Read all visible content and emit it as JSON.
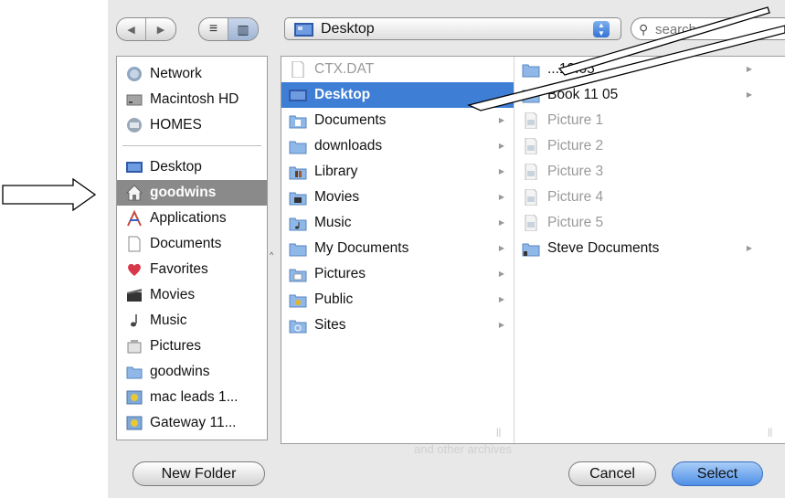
{
  "toolbar": {
    "back_glyph": "◀",
    "forward_glyph": "▶",
    "list_view_glyph": "≡",
    "column_view_glyph": "▥",
    "location": "Desktop",
    "search_placeholder": "search"
  },
  "sidebar": {
    "devices": [
      {
        "label": "Network",
        "icon": "network-icon"
      },
      {
        "label": "Macintosh HD",
        "icon": "hard-drive-icon"
      },
      {
        "label": "HOMES",
        "icon": "network-share-icon"
      }
    ],
    "places": [
      {
        "label": "Desktop",
        "icon": "desktop-icon"
      },
      {
        "label": "goodwins",
        "icon": "home-icon",
        "selected": true
      },
      {
        "label": "Applications",
        "icon": "applications-icon"
      },
      {
        "label": "Documents",
        "icon": "documents-icon"
      },
      {
        "label": "Favorites",
        "icon": "favorites-icon"
      },
      {
        "label": "Movies",
        "icon": "movies-icon"
      },
      {
        "label": "Music",
        "icon": "music-icon"
      },
      {
        "label": "Pictures",
        "icon": "pictures-icon"
      },
      {
        "label": "goodwins",
        "icon": "folder-icon"
      },
      {
        "label": "mac leads 1...",
        "icon": "disk-image-icon"
      },
      {
        "label": "Gateway 11...",
        "icon": "disk-image-icon"
      }
    ]
  },
  "column1": [
    {
      "label": "CTX.DAT",
      "icon": "file-icon",
      "dim": true,
      "chevron": false
    },
    {
      "label": "Desktop",
      "icon": "desktop-icon",
      "selected": true,
      "chevron": false
    },
    {
      "label": "Documents",
      "icon": "documents-folder-icon",
      "chevron": true
    },
    {
      "label": "downloads",
      "icon": "folder-icon",
      "chevron": true
    },
    {
      "label": "Library",
      "icon": "library-folder-icon",
      "chevron": true
    },
    {
      "label": "Movies",
      "icon": "movies-folder-icon",
      "chevron": true
    },
    {
      "label": "Music",
      "icon": "music-folder-icon",
      "chevron": true
    },
    {
      "label": "My Documents",
      "icon": "folder-icon",
      "chevron": true
    },
    {
      "label": "Pictures",
      "icon": "pictures-folder-icon",
      "chevron": true
    },
    {
      "label": "Public",
      "icon": "public-folder-icon",
      "chevron": true
    },
    {
      "label": "Sites",
      "icon": "sites-folder-icon",
      "chevron": true
    }
  ],
  "column2": [
    {
      "label": "...13.05",
      "icon": "folder-icon",
      "chevron": true
    },
    {
      "label": "Book 11 05",
      "icon": "folder-icon",
      "chevron": true
    },
    {
      "label": "Picture 1",
      "icon": "image-file-icon",
      "dim": true
    },
    {
      "label": "Picture 2",
      "icon": "image-file-icon",
      "dim": true
    },
    {
      "label": "Picture 3",
      "icon": "image-file-icon",
      "dim": true
    },
    {
      "label": "Picture 4",
      "icon": "image-file-icon",
      "dim": true
    },
    {
      "label": "Picture 5",
      "icon": "image-file-icon",
      "dim": true
    },
    {
      "label": "Steve Documents",
      "icon": "folder-icon",
      "chevron": true
    }
  ],
  "background_text": "and other archives",
  "buttons": {
    "new_folder": "New Folder",
    "cancel": "Cancel",
    "select": "Select"
  },
  "colors": {
    "selection": "#3e7ed5",
    "sidebar_selection": "#8a8a8a",
    "default_button": "#4f8fe6"
  }
}
